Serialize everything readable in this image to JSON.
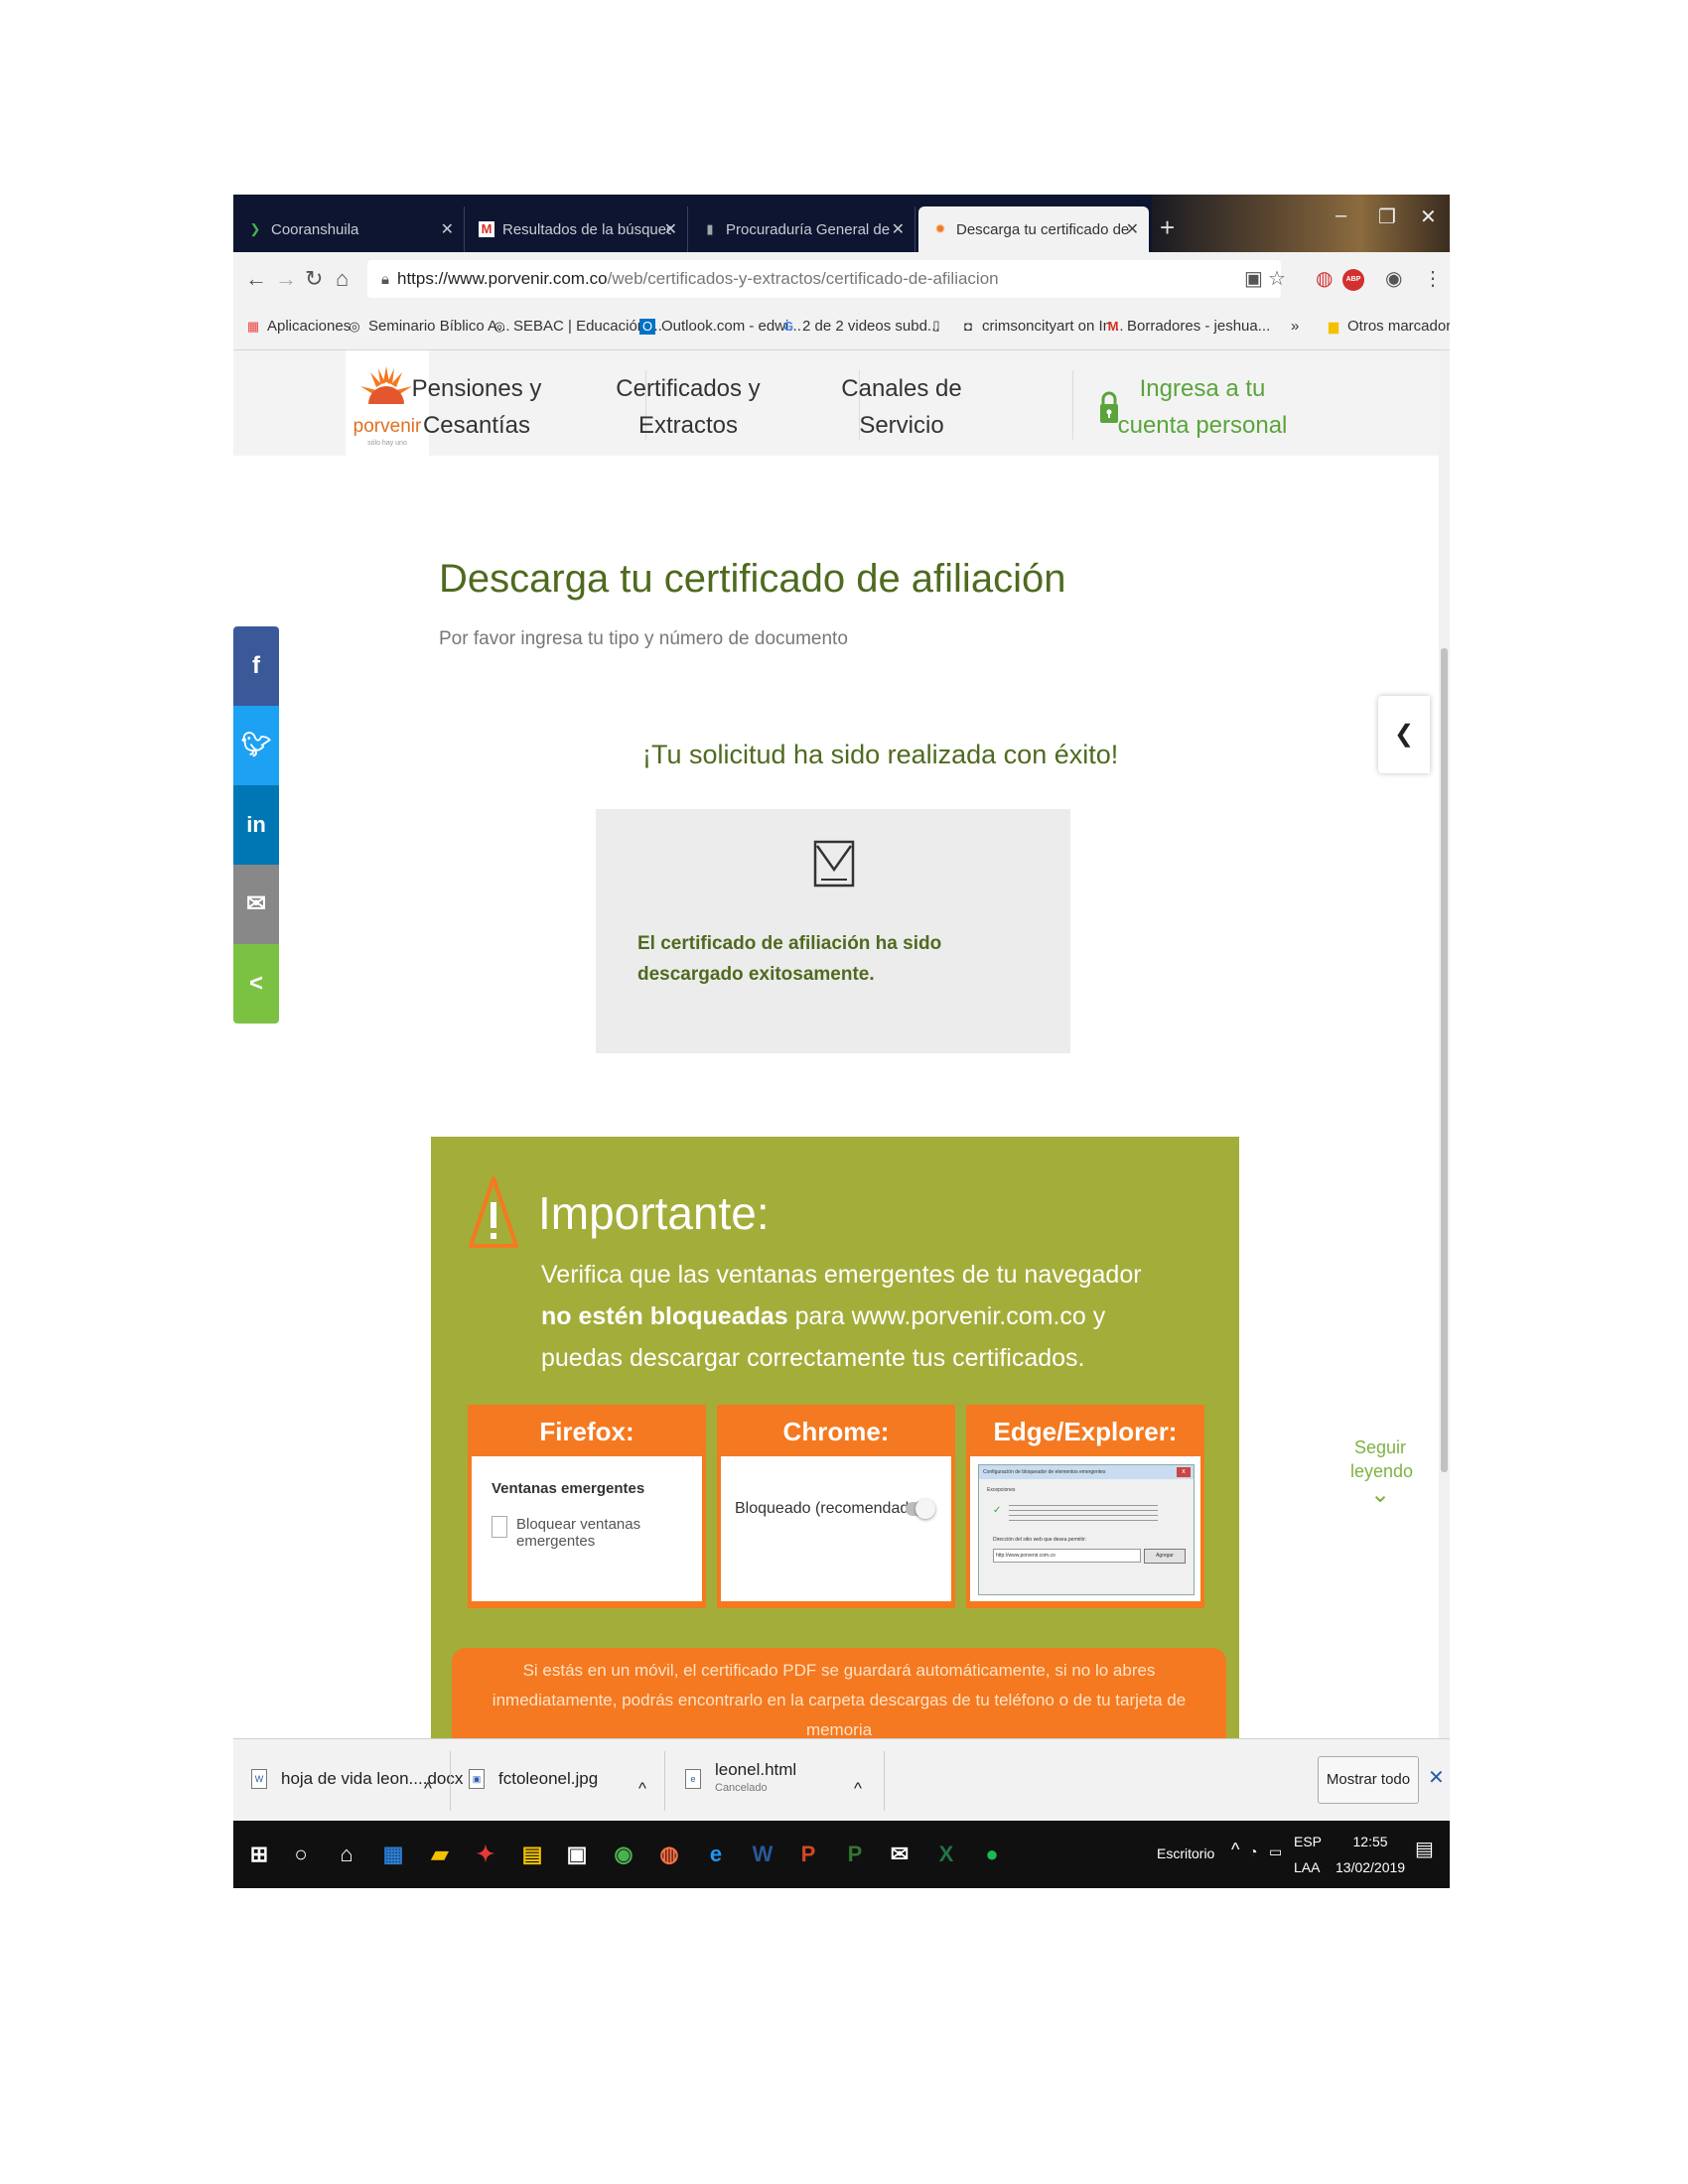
{
  "browser": {
    "tabs": [
      {
        "title": "Cooranshuila",
        "icon": "chevron-right-icon"
      },
      {
        "title": "Resultados de la búsqueda - sau",
        "icon": "gmail-icon"
      },
      {
        "title": "Procuraduría General de la Nació",
        "icon": "government-icon"
      },
      {
        "title": "Descarga tu certificado de afiliac",
        "icon": "porvenir-sun-icon",
        "active": true
      }
    ],
    "url_domain": "https://www.porvenir.com.co",
    "url_path": "/web/certificados-y-extractos/certificado-de-afiliacion",
    "bookmarks": [
      "Aplicaciones",
      "Seminario Bíblico A...",
      "SEBAC | Educación ...",
      "Outlook.com - edwi...",
      "2 de 2 videos subd...",
      "crimsoncityart on In...",
      "Borradores - jeshua..."
    ],
    "bookmarks_overflow": "»",
    "other_bookmarks": "Otros marcadores"
  },
  "site": {
    "logo_text": "porvenir",
    "logo_tagline": "sólo hay uno",
    "nav": [
      {
        "line1": "Pensiones y",
        "line2": "Cesantías"
      },
      {
        "line1": "Certificados y",
        "line2": "Extractos"
      },
      {
        "line1": "Canales de",
        "line2": "Servicio"
      },
      {
        "line1": "Ingresa a tu",
        "line2": "cuenta personal"
      }
    ],
    "share_buttons": [
      "f",
      "t",
      "in",
      "✉",
      "<"
    ]
  },
  "main": {
    "title": "Descarga tu certificado de afiliación",
    "subtitle": "Por favor ingresa tu tipo y número de documento",
    "success": "¡Tu solicitud ha sido realizada con éxito!",
    "download_msg": "El certificado de afiliación ha sido descargado exitosamente."
  },
  "important": {
    "title": "Importante:",
    "text_1": "Verifica que las ventanas emergentes de tu navegador ",
    "text_bold": "no estén bloqueadas",
    "text_2": " para www.porvenir.com.co y puedas descargar correctamente tus certificados.",
    "browsers": [
      {
        "name": "Firefox:",
        "setting_title": "Ventanas emergentes",
        "setting_label": "Bloquear ventanas emergentes"
      },
      {
        "name": "Chrome:",
        "setting_label": "Bloqueado (recomendado)"
      },
      {
        "name": "Edge/Explorer:",
        "dialog_title": "Configuración de bloqueador de elementos emergentes",
        "dialog_section": "Excepciones",
        "dialog_address_label": "Dirección del sitio web que desea permitir:",
        "dialog_address": "http://www.porvenir.com.co",
        "dialog_button": "Agregar"
      }
    ],
    "mobile_note": "Si estás en un móvil, el certificado PDF se guardará automáticamente, si no lo abres inmediatamente, podrás encontrarlo en la carpeta descargas de tu teléfono o de tu tarjeta de memoria"
  },
  "seguir": "Seguir leyendo",
  "downloads": [
    {
      "name": "hoja de vida leon....docx",
      "status": ""
    },
    {
      "name": "fctoleonel.jpg",
      "status": ""
    },
    {
      "name": "leonel.html",
      "status": "Cancelado"
    }
  ],
  "show_all": "Mostrar todo",
  "taskbar": {
    "desktop_label": "Escritorio",
    "lang_1": "ESP",
    "lang_2": "LAA",
    "time": "12:55",
    "date": "13/02/2019"
  },
  "colors": {
    "brand_green": "#4f6a1f",
    "light_green": "#5aa43b",
    "important_bg": "#a3ad3a",
    "orange": "#f47920",
    "facebook": "#3b5998",
    "twitter": "#1da1f2",
    "linkedin": "#0077b5",
    "email": "#888888",
    "share": "#7cc242"
  }
}
